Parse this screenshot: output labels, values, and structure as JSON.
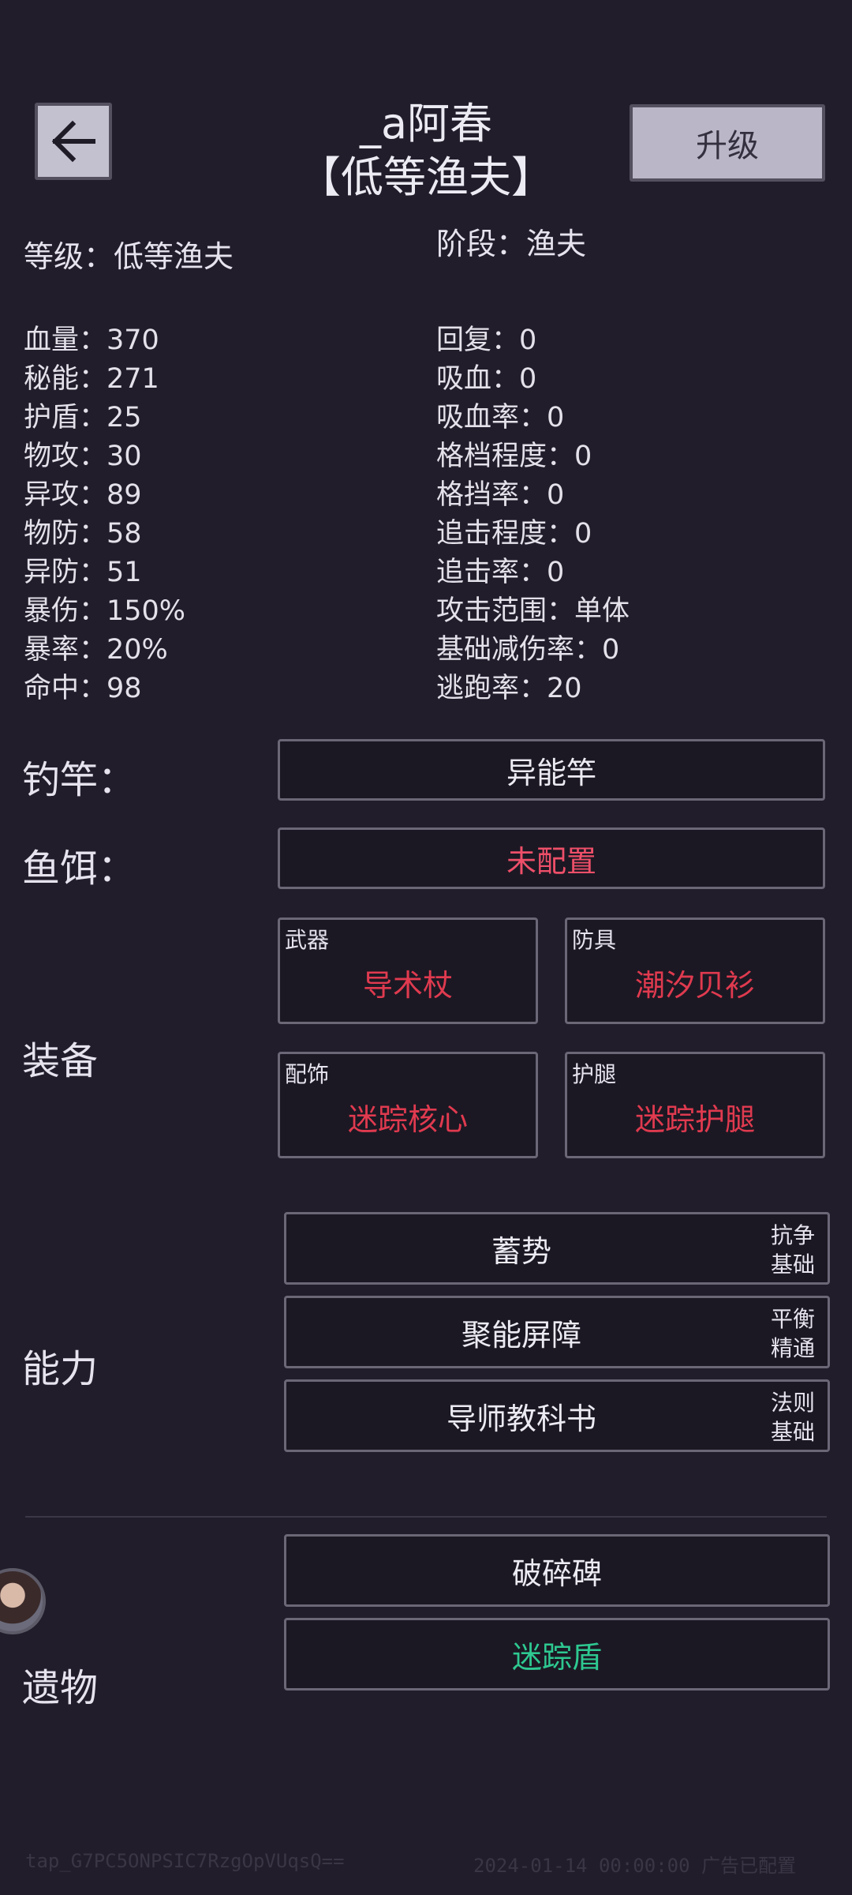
{
  "header": {
    "back_icon": "arrow-left-icon",
    "player_name": "_a阿春",
    "rank_title": "【低等渔夫】",
    "upgrade_label": "升级"
  },
  "level": {
    "level_text": "等级：低等渔夫",
    "stage_text": "阶段：渔夫"
  },
  "stats_left": [
    "血量：370",
    "秘能：271",
    "护盾：25",
    "物攻：30",
    "异攻：89",
    "物防：58",
    "异防：51",
    "暴伤：150%",
    "暴率：20%",
    "命中：98"
  ],
  "stats_right": [
    "回复：0",
    "吸血：0",
    "吸血率：0",
    "格档程度：0",
    "格挡率：0",
    "追击程度：0",
    "追击率：0",
    "攻击范围：单体",
    "基础减伤率：0",
    "逃跑率：20"
  ],
  "rod": {
    "label": "钓竿：",
    "value": "异能竿"
  },
  "bait": {
    "label": "鱼饵：",
    "value": "未配置"
  },
  "equipment": {
    "label": "装备",
    "slots": [
      {
        "slot": "武器",
        "name": "导术杖"
      },
      {
        "slot": "防具",
        "name": "潮汐贝衫"
      },
      {
        "slot": "配饰",
        "name": "迷踪核心"
      },
      {
        "slot": "护腿",
        "name": "迷踪护腿"
      }
    ]
  },
  "abilities": {
    "label": "能力",
    "items": [
      {
        "name": "蓄势",
        "tag": "抗争基础"
      },
      {
        "name": "聚能屏障",
        "tag": "平衡精通"
      },
      {
        "name": "导师教科书",
        "tag": "法则基础"
      }
    ]
  },
  "relics": {
    "label": "遗物",
    "items": [
      {
        "name": "破碎碑"
      },
      {
        "name": "迷踪盾"
      }
    ]
  },
  "footer": {
    "left": "tap_G7PC5ONPSIC7RzgOpVUqsQ==",
    "right": "2024-01-14 00:00:00 广告已配置"
  },
  "colors": {
    "background": "#211d2b",
    "equip_red": "#e03a4f",
    "bait_pink": "#ee4f69",
    "relic_green": "#2ec891"
  }
}
